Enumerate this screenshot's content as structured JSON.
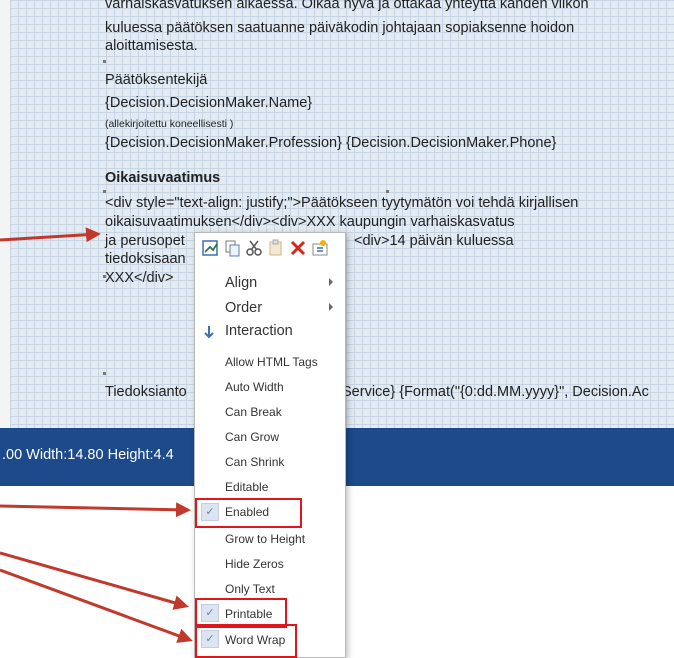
{
  "report": {
    "line1": "varhaiskasvatuksen aikaessa. Oikaa nyva ja ottakaa yhteyttä kanden viikon",
    "line2": "kuluessa päätöksen saatuanne päiväkodin johtajaan sopiaksenne hoidon",
    "line3": "aloittamisesta.",
    "decision_maker_heading": "Päätöksentekijä",
    "decision_maker_name": "{Decision.DecisionMaker.Name}",
    "signed_note": "(allekirjoitettu koneellisesti  )",
    "decision_maker_profession": "{Decision.DecisionMaker.Profession} {Decision.DecisionMaker.Phone}",
    "appeal_heading": "Oikaisuvaatimus",
    "appeal_line1": "<div style=\"text-align: justify;\">Päätökseen tyytymätön voi tehdä kirjallisen",
    "appeal_line2": "oikaisuvaatimuksen</div><div>XXX kaupungin varhaiskasvatus",
    "appeal_line3a": "ja perusopet",
    "appeal_line3b": "<div>14 päivän kuluessa",
    "appeal_line4": "tiedoksisaan",
    "appeal_line5": "XXX</div>",
    "notice_left": "Tiedoksianto",
    "notice_right": "Service} {Format(\"{0:dd.MM.yyyy}\", Decision.Ac"
  },
  "statusbar": {
    "text": ".00 Width:14.80 Height:4.4"
  },
  "toolbar": {
    "icons": [
      "edit-icon",
      "copy-icon",
      "cut-icon",
      "paste-icon",
      "delete-icon",
      "properties-icon"
    ]
  },
  "menu": {
    "align": "Align",
    "order": "Order",
    "interaction": "Interaction",
    "allow_html_tags": "Allow HTML Tags",
    "auto_width": "Auto Width",
    "can_break": "Can Break",
    "can_grow": "Can Grow",
    "can_shrink": "Can Shrink",
    "editable": "Editable",
    "enabled": "Enabled",
    "grow_to_height": "Grow to Height",
    "hide_zeros": "Hide Zeros",
    "only_text": "Only Text",
    "printable": "Printable",
    "word_wrap": "Word Wrap"
  },
  "colors": {
    "statusbar": "#1c4a8a",
    "highlight": "#e0161c",
    "grid": "#e3eaf2"
  }
}
